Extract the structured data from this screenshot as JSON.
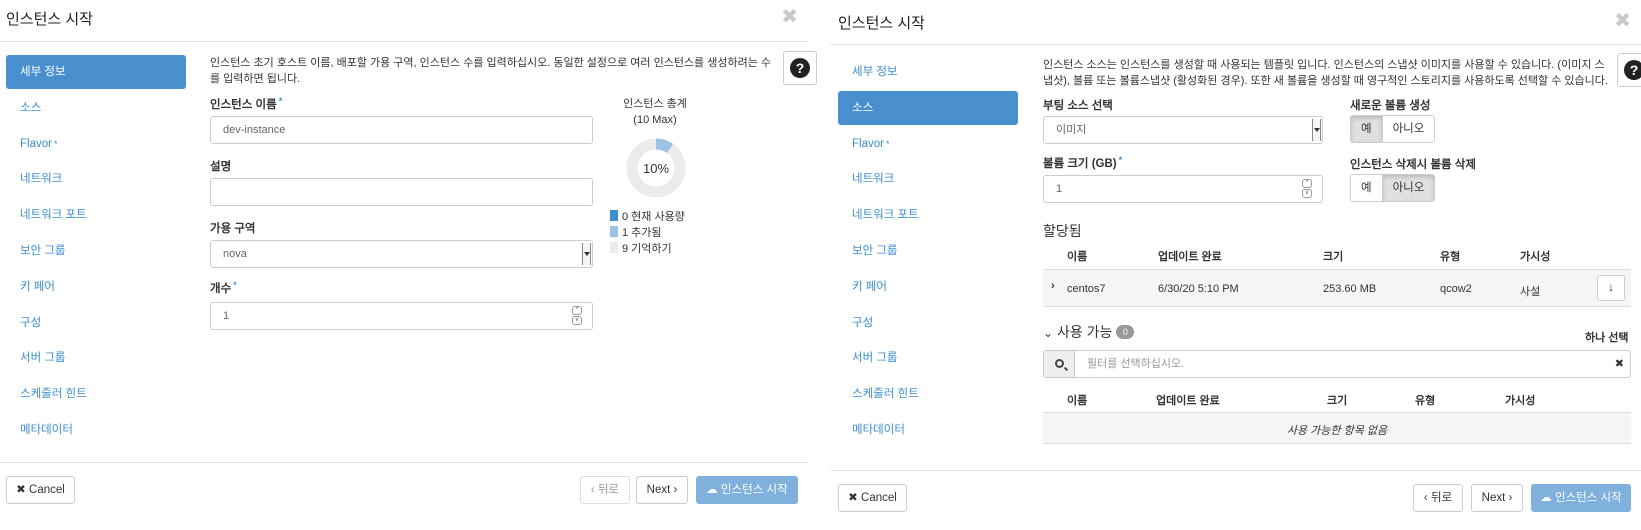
{
  "left": {
    "title": "인스턴스 시작",
    "close": "✖",
    "nav": [
      {
        "label": "세부 정보",
        "required": false
      },
      {
        "label": "소스",
        "required": false
      },
      {
        "label": "Flavor",
        "required": true
      },
      {
        "label": "네트워크",
        "required": false
      },
      {
        "label": "네트워크 포트",
        "required": false
      },
      {
        "label": "보안 그룹",
        "required": false
      },
      {
        "label": "키 페어",
        "required": false
      },
      {
        "label": "구성",
        "required": false
      },
      {
        "label": "서버 그룹",
        "required": false
      },
      {
        "label": "스케줄러 힌트",
        "required": false
      },
      {
        "label": "메타데이터",
        "required": false
      }
    ],
    "required_mark": "*",
    "help": "?",
    "description_line1": "인스턴스 초기 호스트 이름, 배포할 가용 구역, 인스턴스 수를 입력하십시오. 동일한 설정으로 여러 인스턴스를 생성하려는 수",
    "description_line2": "를 입력하면 됩니다.",
    "instance_name_label": "인스턴스 이름",
    "instance_name_value": "dev-instance",
    "desc_label": "설명",
    "desc_value": "",
    "az_label": "가용 구역",
    "az_value": "nova",
    "count_label": "개수",
    "count_value": "1",
    "spin_up": "^",
    "spin_down": "v",
    "chart_title_line1": "인스턴스 총계",
    "chart_title_line2": "(10 Max)",
    "chart_center": "10%",
    "cancel": "Cancel",
    "back": "뒤로",
    "next": "Next",
    "launch": "인스턴스 시작"
  },
  "chart_data": {
    "type": "pie",
    "title": "인스턴스 총계",
    "subtitle": "(10 Max)",
    "center_label": "10%",
    "max": 10,
    "slices": [
      {
        "label": "현재 사용량",
        "value": 0,
        "color": "#3c8dcc"
      },
      {
        "label": "추가됨",
        "value": 1,
        "color": "#9cc3e6"
      },
      {
        "label": "기억하기",
        "value": 9,
        "color": "#ebebeb"
      }
    ]
  },
  "right": {
    "title": "인스턴스 시작",
    "close": "✖",
    "nav": [
      {
        "label": "세부 정보",
        "required": false
      },
      {
        "label": "소스",
        "required": false
      },
      {
        "label": "Flavor",
        "required": true
      },
      {
        "label": "네트워크",
        "required": false
      },
      {
        "label": "네트워크 포트",
        "required": false
      },
      {
        "label": "보안 그룹",
        "required": false
      },
      {
        "label": "키 페어",
        "required": false
      },
      {
        "label": "구성",
        "required": false
      },
      {
        "label": "서버 그룹",
        "required": false
      },
      {
        "label": "스케줄러 힌트",
        "required": false
      },
      {
        "label": "메타데이터",
        "required": false
      }
    ],
    "required_mark": "*",
    "help": "?",
    "description_line1": "인스턴스 소스는 인스턴스를 생성할 때 사용되는 템플릿 입니다. 인스턴스의 스냅샷 이미지를 사용할 수 있습니다. (이미지 스",
    "description_line2": "냅샷), 볼륨 또는 볼륨스냅샷 (활성화된 경우). 또한 새 볼륨을 생성할 때 영구적인 스토리지를 사용하도록 선택할 수 있습니다.",
    "boot_source_label": "부팅 소스 선택",
    "boot_source_value": "이미지",
    "new_volume_label": "새로운 볼륨 생성",
    "yes": "예",
    "no": "아니오",
    "volume_size_label": "볼륨 크기 (GB)",
    "volume_size_value": "1",
    "spin_up": "^",
    "spin_down": "v",
    "delete_volume_label": "인스턴스 삭제시 볼륨 삭제",
    "allocated_title": "할당됨",
    "allocated_columns": [
      "이름",
      "업데이트 완료",
      "크기",
      "유형",
      "가시성"
    ],
    "allocated_rows": [
      {
        "name": "centos7",
        "updated": "6/30/20 5:10 PM",
        "size": "253.60 MB",
        "type": "qcow2",
        "visibility": "사설"
      }
    ],
    "available_title": "사용 가능",
    "available_count": "0",
    "select_one": "하나 선택",
    "filter_placeholder": "필터를 선택하십시오.",
    "filter_clear": "✖",
    "available_columns": [
      "이름",
      "업데이트 완료",
      "크기",
      "유형",
      "가시성"
    ],
    "empty_message": "사용 가능한 항목 없음",
    "cancel": "Cancel",
    "back": "뒤로",
    "next": "Next",
    "launch": "인스턴스 시작"
  }
}
